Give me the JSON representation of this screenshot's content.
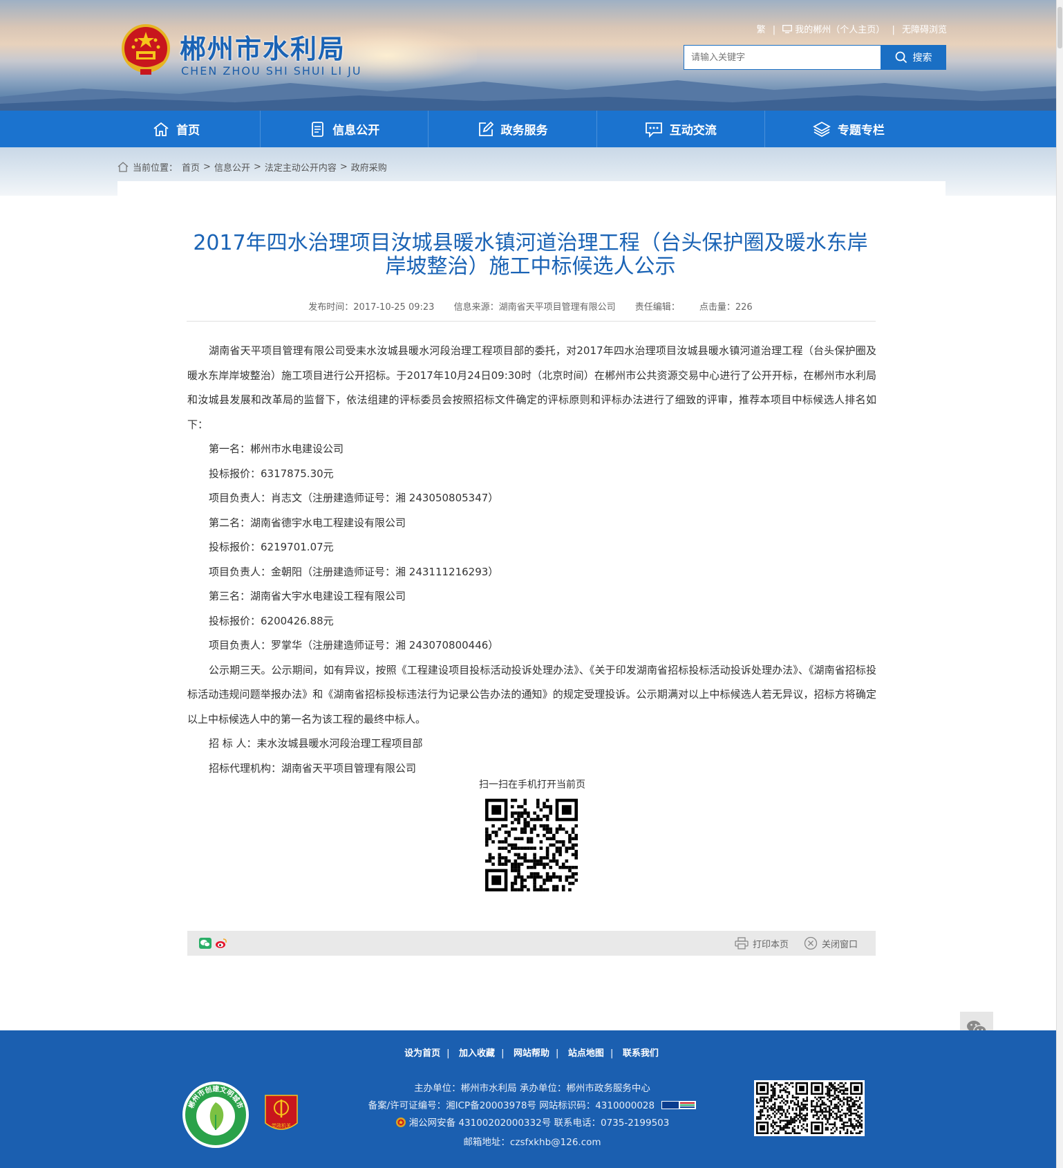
{
  "header": {
    "site_title": "郴州市水利局",
    "site_subtitle": "CHEN ZHOU SHI SHUI LI JU",
    "top_links": {
      "traditional": "繁",
      "my_chenzhou": "我的郴州（个人主页）",
      "accessible": "无障碍浏览"
    },
    "search": {
      "placeholder": "请输入关键字",
      "button_label": "搜索"
    }
  },
  "nav": {
    "items": [
      {
        "label": "首页",
        "icon": "home-icon"
      },
      {
        "label": "信息公开",
        "icon": "document-icon"
      },
      {
        "label": "政务服务",
        "icon": "edit-icon"
      },
      {
        "label": "互动交流",
        "icon": "chat-icon"
      },
      {
        "label": "专题专栏",
        "icon": "layers-icon"
      }
    ]
  },
  "breadcrumb": {
    "prefix": "当前位置：",
    "items": [
      "首页",
      "信息公开",
      "法定主动公开内容",
      "政府采购"
    ]
  },
  "article": {
    "title": "2017年四水治理项目汝城县暖水镇河道治理工程（台头保护圈及暖水东岸岸坡整治）施工中标候选人公示",
    "meta": {
      "publish_time": "发布时间：2017-10-25 09:23",
      "source": "信息来源：湖南省天平项目管理有限公司",
      "editor": "责任编辑：",
      "clicks": "点击量：226"
    },
    "paragraphs": [
      "湖南省天平项目管理有限公司受耒水汝城县暖水河段治理工程项目部的委托，对2017年四水治理项目汝城县暖水镇河道治理工程（台头保护圈及暖水东岸岸坡整治）施工项目进行公开招标。于2017年10月24日09:30时（北京时间）在郴州市公共资源交易中心进行了公开开标，在郴州市水利局和汝城县发展和改革局的监督下，依法组建的评标委员会按照招标文件确定的评标原则和评标办法进行了细致的评审，推荐本项目中标候选人排名如下：",
      "第一名：郴州市水电建设公司",
      "投标报价：6317875.30元",
      "项目负责人：肖志文（注册建造师证号：湘 243050805347）",
      "第二名：湖南省德宇水电工程建设有限公司",
      "投标报价：6219701.07元",
      "项目负责人：金朝阳（注册建造师证号：湘 243111216293）",
      "第三名：湖南省大宇水电建设工程有限公司",
      "投标报价：6200426.88元",
      "项目负责人：罗掌华（注册建造师证号：湘 243070800446）",
      "公示期三天。公示期间，如有异议，按照《工程建设项目投标活动投诉处理办法》、《关于印发湖南省招标投标活动投诉处理办法》、《湖南省招标投标活动违规问题举报办法》和《湖南省招标投标违法行为记录公告办法的通知》的规定受理投诉。公示期满对以上中标候选人若无异议，招标方将确定以上中标候选人中的第一名为该工程的最终中标人。",
      "招 标 人：耒水汝城县暖水河段治理工程项目部",
      "招标代理机构：湖南省天平项目管理有限公司"
    ],
    "qr_caption": "扫一扫在手机打开当前页"
  },
  "sharebar": {
    "print": "打印本页",
    "close": "关闭窗口"
  },
  "footer": {
    "links": [
      "设为首页",
      "加入收藏",
      "网站帮助",
      "站点地图",
      "联系我们"
    ],
    "sponsor": "主办单位：郴州市水利局   承办单位：郴州市政务服务中心",
    "icp": "备案/许可证编号：湘ICP备20003978号   网站标识码：4310000028",
    "police": "湘公网安备 43100202000332号   联系电话：0735-2199503",
    "email": "邮箱地址：czsfxkhb@126.com",
    "badge_civil": "郴州市创建文明城市",
    "badge_party": "党政机关"
  },
  "colors": {
    "brand_blue": "#1b73cf",
    "title_blue": "#1a63b5",
    "footer_blue": "#1b5fb0"
  }
}
